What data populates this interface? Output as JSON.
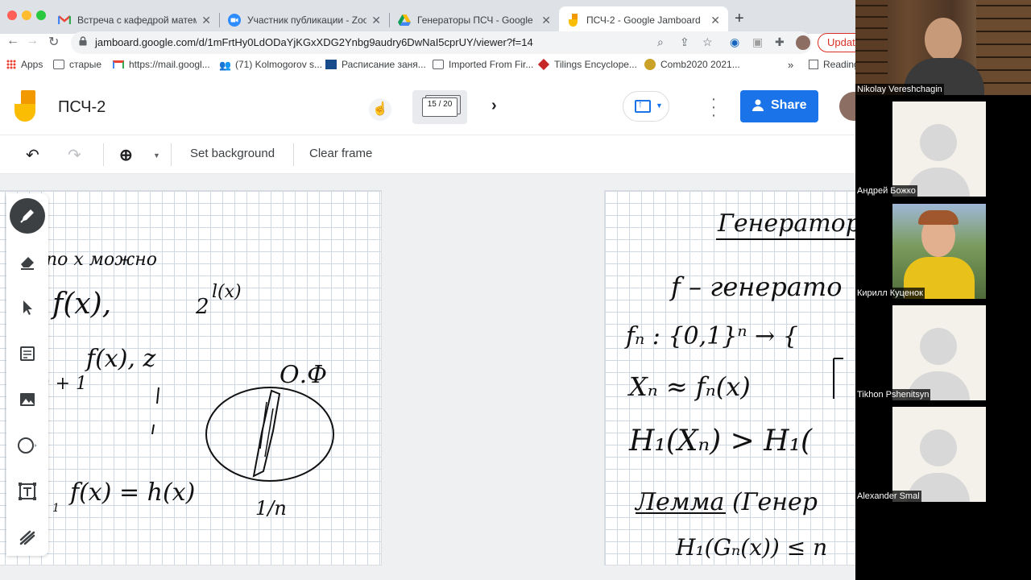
{
  "browser": {
    "tabs": [
      {
        "label": "Встреча с кафедрой математ",
        "icon": "gmail-icon",
        "active": false
      },
      {
        "label": "Участник публикации - Zoom",
        "icon": "zoom-icon",
        "active": false
      },
      {
        "label": "Генераторы ПСЧ - Google Dri",
        "icon": "google-drive-icon",
        "active": false
      },
      {
        "label": "ПСЧ-2 - Google Jamboard",
        "icon": "jamboard-icon",
        "active": true
      }
    ],
    "url": "jamboard.google.com/d/1mFrtHy0LdODaYjKGxXDG2Ynbg9audry6DwNaI5cprUY/viewer?f=14",
    "update_label": "Update",
    "bookmarks": [
      {
        "label": "Apps",
        "icon": "apps-grid-icon"
      },
      {
        "label": "старые",
        "icon": "folder-icon"
      },
      {
        "label": "https://mail.googl...",
        "icon": "gmail-icon"
      },
      {
        "label": "(71) Kolmogorov s...",
        "icon": "people-icon"
      },
      {
        "label": "Расписание заня...",
        "icon": "calendar-icon"
      },
      {
        "label": "Imported From Fir...",
        "icon": "folder-icon"
      },
      {
        "label": "Tilings Encyclope...",
        "icon": "tiling-icon"
      },
      {
        "label": "Comb2020 2021...",
        "icon": "globe-icon"
      }
    ],
    "reading_list": "Reading"
  },
  "jamboard": {
    "title": "ПСЧ-2",
    "frame_counter": "15 / 20",
    "share_label": "Share",
    "toolbar": {
      "set_background": "Set background",
      "clear_frame": "Clear frame"
    }
  },
  "whiteboard_text": {
    "left_frame": [
      "по x можно",
      "f(x),",
      "2",
      "l(x)",
      "f(x), z",
      ") + 1",
      "О.Ф",
      "1",
      "f(x) = h(x)",
      "1/n"
    ],
    "right_frame": [
      "Генератор",
      "f – генерато",
      "fₙ : {0,1}ⁿ → {",
      "Xₙ ≈ fₙ(x)",
      "H₁(Xₙ) > H₁(",
      "Лемма (Генер",
      "H₁(Gₙ(x)) ≤ n"
    ]
  },
  "zoom": {
    "participants": [
      {
        "name": "Nikolay Vereshchagin",
        "video": true
      },
      {
        "name": "Андрей Божко",
        "video": false
      },
      {
        "name": "Кирилл Куценок",
        "video": true
      },
      {
        "name": "Tikhon Pshenitsyn",
        "video": false
      },
      {
        "name": "Alexander Smal",
        "video": false
      }
    ]
  },
  "colors": {
    "tab_strip": "#dee1e6",
    "share_button": "#1a73e8",
    "jamboard_yellow": "#fbbc04",
    "jamboard_orange": "#f29900",
    "update_red": "#d93025"
  }
}
